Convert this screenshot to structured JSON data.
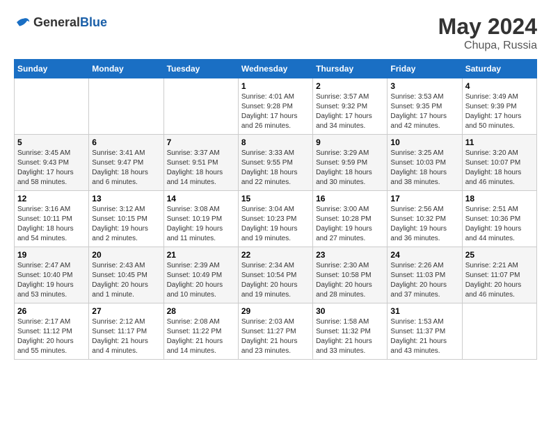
{
  "logo": {
    "general": "General",
    "blue": "Blue"
  },
  "title": {
    "month_year": "May 2024",
    "location": "Chupa, Russia"
  },
  "headers": [
    "Sunday",
    "Monday",
    "Tuesday",
    "Wednesday",
    "Thursday",
    "Friday",
    "Saturday"
  ],
  "weeks": [
    [
      {
        "day": "",
        "info": ""
      },
      {
        "day": "",
        "info": ""
      },
      {
        "day": "",
        "info": ""
      },
      {
        "day": "1",
        "info": "Sunrise: 4:01 AM\nSunset: 9:28 PM\nDaylight: 17 hours and 26 minutes."
      },
      {
        "day": "2",
        "info": "Sunrise: 3:57 AM\nSunset: 9:32 PM\nDaylight: 17 hours and 34 minutes."
      },
      {
        "day": "3",
        "info": "Sunrise: 3:53 AM\nSunset: 9:35 PM\nDaylight: 17 hours and 42 minutes."
      },
      {
        "day": "4",
        "info": "Sunrise: 3:49 AM\nSunset: 9:39 PM\nDaylight: 17 hours and 50 minutes."
      }
    ],
    [
      {
        "day": "5",
        "info": "Sunrise: 3:45 AM\nSunset: 9:43 PM\nDaylight: 17 hours and 58 minutes."
      },
      {
        "day": "6",
        "info": "Sunrise: 3:41 AM\nSunset: 9:47 PM\nDaylight: 18 hours and 6 minutes."
      },
      {
        "day": "7",
        "info": "Sunrise: 3:37 AM\nSunset: 9:51 PM\nDaylight: 18 hours and 14 minutes."
      },
      {
        "day": "8",
        "info": "Sunrise: 3:33 AM\nSunset: 9:55 PM\nDaylight: 18 hours and 22 minutes."
      },
      {
        "day": "9",
        "info": "Sunrise: 3:29 AM\nSunset: 9:59 PM\nDaylight: 18 hours and 30 minutes."
      },
      {
        "day": "10",
        "info": "Sunrise: 3:25 AM\nSunset: 10:03 PM\nDaylight: 18 hours and 38 minutes."
      },
      {
        "day": "11",
        "info": "Sunrise: 3:20 AM\nSunset: 10:07 PM\nDaylight: 18 hours and 46 minutes."
      }
    ],
    [
      {
        "day": "12",
        "info": "Sunrise: 3:16 AM\nSunset: 10:11 PM\nDaylight: 18 hours and 54 minutes."
      },
      {
        "day": "13",
        "info": "Sunrise: 3:12 AM\nSunset: 10:15 PM\nDaylight: 19 hours and 2 minutes."
      },
      {
        "day": "14",
        "info": "Sunrise: 3:08 AM\nSunset: 10:19 PM\nDaylight: 19 hours and 11 minutes."
      },
      {
        "day": "15",
        "info": "Sunrise: 3:04 AM\nSunset: 10:23 PM\nDaylight: 19 hours and 19 minutes."
      },
      {
        "day": "16",
        "info": "Sunrise: 3:00 AM\nSunset: 10:28 PM\nDaylight: 19 hours and 27 minutes."
      },
      {
        "day": "17",
        "info": "Sunrise: 2:56 AM\nSunset: 10:32 PM\nDaylight: 19 hours and 36 minutes."
      },
      {
        "day": "18",
        "info": "Sunrise: 2:51 AM\nSunset: 10:36 PM\nDaylight: 19 hours and 44 minutes."
      }
    ],
    [
      {
        "day": "19",
        "info": "Sunrise: 2:47 AM\nSunset: 10:40 PM\nDaylight: 19 hours and 53 minutes."
      },
      {
        "day": "20",
        "info": "Sunrise: 2:43 AM\nSunset: 10:45 PM\nDaylight: 20 hours and 1 minute."
      },
      {
        "day": "21",
        "info": "Sunrise: 2:39 AM\nSunset: 10:49 PM\nDaylight: 20 hours and 10 minutes."
      },
      {
        "day": "22",
        "info": "Sunrise: 2:34 AM\nSunset: 10:54 PM\nDaylight: 20 hours and 19 minutes."
      },
      {
        "day": "23",
        "info": "Sunrise: 2:30 AM\nSunset: 10:58 PM\nDaylight: 20 hours and 28 minutes."
      },
      {
        "day": "24",
        "info": "Sunrise: 2:26 AM\nSunset: 11:03 PM\nDaylight: 20 hours and 37 minutes."
      },
      {
        "day": "25",
        "info": "Sunrise: 2:21 AM\nSunset: 11:07 PM\nDaylight: 20 hours and 46 minutes."
      }
    ],
    [
      {
        "day": "26",
        "info": "Sunrise: 2:17 AM\nSunset: 11:12 PM\nDaylight: 20 hours and 55 minutes."
      },
      {
        "day": "27",
        "info": "Sunrise: 2:12 AM\nSunset: 11:17 PM\nDaylight: 21 hours and 4 minutes."
      },
      {
        "day": "28",
        "info": "Sunrise: 2:08 AM\nSunset: 11:22 PM\nDaylight: 21 hours and 14 minutes."
      },
      {
        "day": "29",
        "info": "Sunrise: 2:03 AM\nSunset: 11:27 PM\nDaylight: 21 hours and 23 minutes."
      },
      {
        "day": "30",
        "info": "Sunrise: 1:58 AM\nSunset: 11:32 PM\nDaylight: 21 hours and 33 minutes."
      },
      {
        "day": "31",
        "info": "Sunrise: 1:53 AM\nSunset: 11:37 PM\nDaylight: 21 hours and 43 minutes."
      },
      {
        "day": "",
        "info": ""
      }
    ]
  ]
}
